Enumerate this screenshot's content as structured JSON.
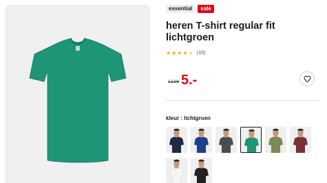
{
  "product": {
    "badges": {
      "essential": "essential",
      "sale": "sale"
    },
    "title": "heren T-shirt regular fit lichtgroen",
    "rating": {
      "value": 4.5,
      "max": 5,
      "count_text": "(15)"
    },
    "price": {
      "old": "12,99",
      "new": "5.-"
    },
    "color_label": "kleur : lichtgroen",
    "selected_color": "lichtgroen",
    "image_shirt_color": "#1f9577"
  },
  "swatches": [
    {
      "name": "navy",
      "shirt_color": "#1f2a44",
      "selected": false
    },
    {
      "name": "blue",
      "shirt_color": "#1e3f8a",
      "selected": false
    },
    {
      "name": "grey",
      "shirt_color": "#4a4d4c",
      "selected": false
    },
    {
      "name": "lichtgroen",
      "shirt_color": "#1f9577",
      "selected": true
    },
    {
      "name": "olive",
      "shirt_color": "#7c8a52",
      "selected": false
    },
    {
      "name": "burgundy",
      "shirt_color": "#7a3038",
      "selected": false
    },
    {
      "name": "white",
      "shirt_color": "#f4f4f4",
      "selected": false
    },
    {
      "name": "black",
      "shirt_color": "#222222",
      "selected": false
    }
  ],
  "icons": {
    "wishlist": "heart-icon",
    "rating": "star-icon"
  }
}
